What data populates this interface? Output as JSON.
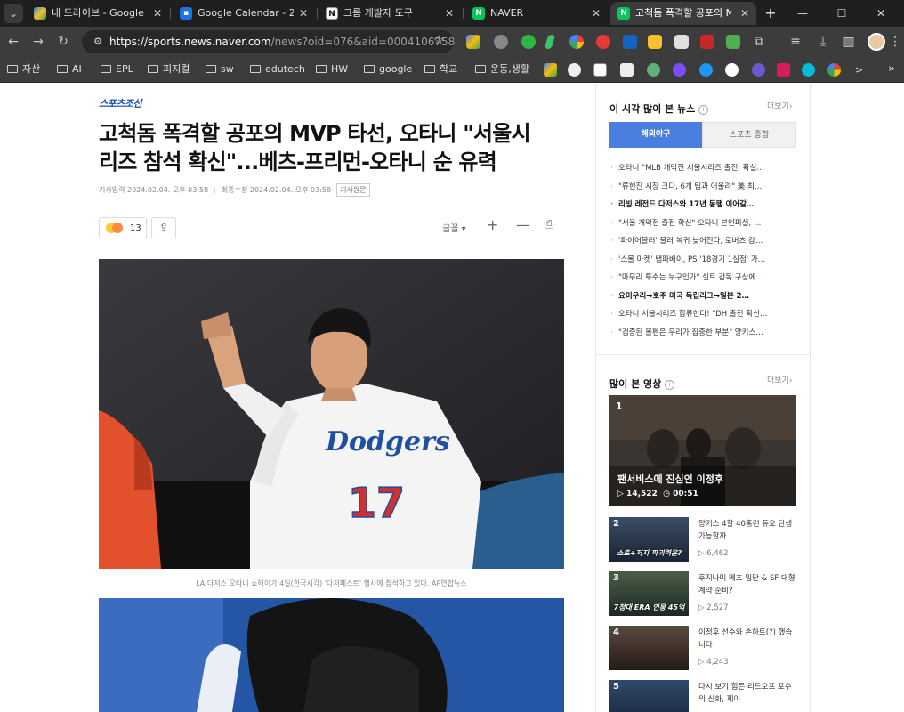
{
  "tabs": [
    {
      "title": "내 드라이브 - Google D",
      "favicon": "drive-icon",
      "active": false
    },
    {
      "title": "Google Calendar - 2024",
      "favicon": "calendar-icon",
      "active": false
    },
    {
      "title": "크롬 개발자 도구",
      "favicon": "notion-icon",
      "active": false
    },
    {
      "title": "NAVER",
      "favicon": "naver-icon",
      "active": false
    },
    {
      "title": "고척돔 폭격할 공포의 M",
      "favicon": "naver-icon",
      "active": true
    }
  ],
  "toolbar": {
    "url_host": "https://sports.news.naver.com",
    "url_path": "/news?oid=076&aid=0004106758"
  },
  "bookmarks": [
    {
      "label": "자산"
    },
    {
      "label": "AI"
    },
    {
      "label": "EPL"
    },
    {
      "label": "피지컬"
    },
    {
      "label": "sw"
    },
    {
      "label": "edutech"
    },
    {
      "label": "HW"
    },
    {
      "label": "google"
    },
    {
      "label": "학교"
    },
    {
      "label": "운동,생활"
    }
  ],
  "article": {
    "press": "스포츠조선",
    "headline_line1": "고척돔 폭격할 공포의 MVP 타선, 오타니 \"서울시",
    "headline_line2": "리즈 참석 확신\"...베츠-프리먼-오타니 순 유력",
    "published": "기사입력 2024.02.04. 오후 03:58",
    "modified": "최종수정 2024.02.04. 오후 03:58",
    "original_link": "기사원문",
    "reaction_count": "13",
    "font_label": "글꼴",
    "photo1_caption": "LA 다저스 오타니 쇼헤이가 4일(한국시각) '다저페스트' 행사에 참석하고 있다. AP연합뉴스",
    "jersey_team": "Dodgers",
    "jersey_number": "17"
  },
  "sidebar": {
    "popular_title": "이 시각 많이 본 뉴스",
    "more": "더보기",
    "tab_mlb": "해외야구",
    "tab_all": "스포츠 종합",
    "ranked_news": [
      {
        "text": "오타니 \"MLB 개막전 서울시리즈 출전, 확실…",
        "bold": false
      },
      {
        "text": "\"류현진 시장 크다, 6개 팀과 어울려\" 美 최…",
        "bold": false
      },
      {
        "text": "리빙 레전드 다저스와 17년 동행 이어갈…",
        "bold": true
      },
      {
        "text": "\"서울 개막전 출전 확신\" 오타니 본인피셜, …",
        "bold": false
      },
      {
        "text": "'파이어볼러' 불러 복귀 늦어진다, 로버츠 감…",
        "bold": false
      },
      {
        "text": "'스몰 마켓' 탬파베이, PS '18경기 1실점' 가…",
        "bold": false
      },
      {
        "text": "\"마무리 투수는 누구인가\" 실트 감독 구상에…",
        "bold": false
      },
      {
        "text": "요미우리→호주 미국 독립리그→일본 2…",
        "bold": true
      },
      {
        "text": "오타니 서울시리즈 합류한다! \"DH 출전 확신…",
        "bold": false
      },
      {
        "text": "\"검증된 볼펜은 우리가 집중한 부분\" 양키스…",
        "bold": false
      }
    ],
    "video_title": "많이 본 영상",
    "video_more": "더보기",
    "top_video": {
      "rank": "1",
      "title": "팬서비스에 진심인 이정후",
      "views": "▷ 14,522",
      "duration": "◷ 00:51"
    },
    "videos": [
      {
        "rank": "2",
        "caption": "소토+저지 파괴력은?",
        "title": "양키스 4할 40홈런 듀오 탄생 가능할까",
        "views": "▷ 6,462"
      },
      {
        "rank": "3",
        "caption": "7정대 ERA 인몽 45억",
        "title": "후지나미 메츠 입단 & SF 대형 계약 준비?",
        "views": "▷ 2,527"
      },
      {
        "rank": "4",
        "caption": "",
        "title": "이정후 선수와 손하트(?) 했습니다",
        "views": "▷ 4,243"
      },
      {
        "rank": "5",
        "caption": "",
        "title": "다시 보기 힘든 리드오프 포수의 신화, 제이",
        "views": ""
      }
    ]
  }
}
